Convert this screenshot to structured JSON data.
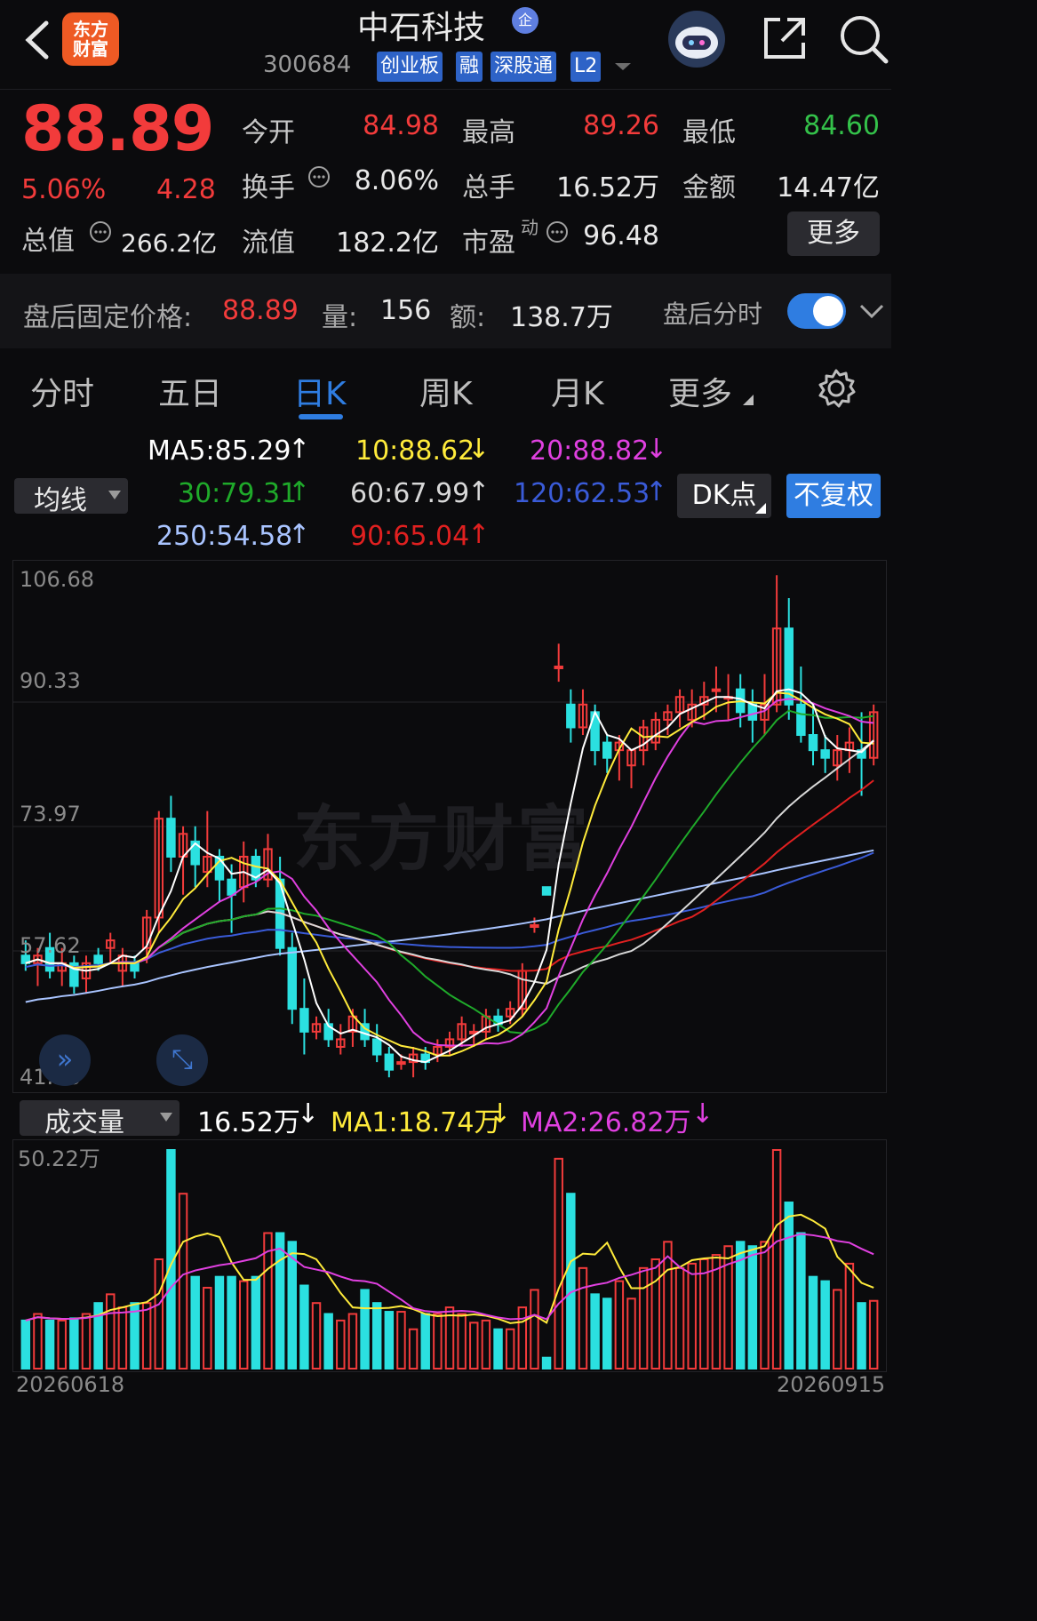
{
  "header": {
    "logo": "东方\n财富",
    "title": "中石科技",
    "qi_badge": "企",
    "code": "300684",
    "tags": [
      "创业板",
      "融",
      "深股通",
      "L2"
    ]
  },
  "quote": {
    "price": "88.89",
    "change_pct": "5.06%",
    "change": "4.28",
    "open_label": "今开",
    "open": "84.98",
    "high_label": "最高",
    "high": "89.26",
    "low_label": "最低",
    "low": "84.60",
    "turnover_label": "换手",
    "turnover": "8.06%",
    "volume_label": "总手",
    "volume": "16.52万",
    "amount_label": "金额",
    "amount": "14.47亿",
    "mcap_label": "总值",
    "mcap": "266.2亿",
    "float_label": "流值",
    "float": "182.2亿",
    "pe_label": "市盈",
    "pe_sup": "动",
    "pe": "96.48",
    "more_label": "更多"
  },
  "afterhours": {
    "price_label": "盘后固定价格:",
    "price": "88.89",
    "vol_label": "量:",
    "vol": "156",
    "amt_label": "额:",
    "amt": "138.7万",
    "toggle_label": "盘后分时"
  },
  "tabs": [
    "分时",
    "五日",
    "日K",
    "周K",
    "月K",
    "更多"
  ],
  "ma_row": {
    "selector": "均线",
    "ma5": "MA5:85.29",
    "ma10": "10:88.62",
    "ma20": "20:88.82",
    "ma30": "30:79.31",
    "ma60": "60:67.99",
    "ma120": "120:62.53",
    "ma250": "250:54.58",
    "ma90": "90:65.04",
    "dk": "DK点",
    "fq": "不复权"
  },
  "main_axis": {
    "top": "106.68",
    "l2": "90.33",
    "l3": "73.97",
    "l4": "57.62",
    "bottom": "41.26"
  },
  "volume_panel": {
    "selector": "成交量",
    "value": "16.52万",
    "ma1": "MA1:18.74万",
    "ma2": "MA2:26.82万",
    "axis_top": "50.22万",
    "date_start": "20260618",
    "date_end": "20260915"
  },
  "watermark": "东方财富",
  "colors": {
    "up": "#f23b3b",
    "down": "#2be0e0",
    "ma5": "#ffffff",
    "ma10": "#ffeb3b",
    "ma20": "#e040e0",
    "ma30": "#1faa2a",
    "ma60": "#d8d8d8",
    "ma120": "#3a5bd8",
    "ma250": "#a9c4ff",
    "ma90": "#e02020",
    "accent": "#2f7de1"
  },
  "chart_data": {
    "type": "candlestick",
    "candles": [
      [
        57,
        59,
        55,
        56
      ],
      [
        56,
        58,
        53,
        57
      ],
      [
        58,
        60,
        54,
        55
      ],
      [
        55,
        58,
        53,
        56
      ],
      [
        56,
        57,
        52,
        53
      ],
      [
        54,
        57,
        52,
        56
      ],
      [
        57,
        58,
        55,
        56
      ],
      [
        58,
        60,
        56,
        59
      ],
      [
        55,
        58,
        53,
        57
      ],
      [
        56,
        57,
        54,
        55
      ],
      [
        58,
        63,
        56,
        62
      ],
      [
        62,
        76,
        60,
        75
      ],
      [
        75,
        78,
        68,
        70
      ],
      [
        70,
        74,
        65,
        73
      ],
      [
        72,
        74,
        66,
        69
      ],
      [
        68,
        76,
        66,
        70
      ],
      [
        70,
        71,
        64,
        67
      ],
      [
        67,
        69,
        60,
        65
      ],
      [
        66,
        72,
        64,
        70
      ],
      [
        70,
        71,
        66,
        67
      ],
      [
        67,
        73,
        66,
        71
      ],
      [
        67,
        70,
        57,
        58
      ],
      [
        58,
        60,
        48,
        50
      ],
      [
        50,
        54,
        44,
        47
      ],
      [
        47,
        49,
        46,
        48
      ],
      [
        48,
        50,
        45,
        46
      ],
      [
        45,
        48,
        44,
        46
      ],
      [
        47,
        50,
        45,
        49
      ],
      [
        48,
        50,
        45,
        46
      ],
      [
        46,
        48,
        43,
        44
      ],
      [
        44,
        45,
        41,
        42
      ],
      [
        43,
        44,
        42,
        43
      ],
      [
        43,
        45,
        41,
        44
      ],
      [
        44,
        45,
        42,
        43
      ],
      [
        44,
        46,
        43,
        45
      ],
      [
        45,
        47,
        44,
        46
      ],
      [
        46,
        49,
        45,
        48
      ],
      [
        47,
        48,
        45,
        47
      ],
      [
        47,
        50,
        46,
        49
      ],
      [
        49,
        50,
        47,
        48
      ],
      [
        49,
        51,
        48,
        50
      ],
      [
        50,
        56,
        49,
        55
      ],
      [
        61,
        62,
        60,
        61
      ],
      [
        66,
        66,
        65,
        65
      ],
      [
        95,
        98,
        93,
        95
      ],
      [
        90,
        92,
        85,
        87
      ],
      [
        87,
        92,
        86,
        90
      ],
      [
        89,
        90,
        82,
        84
      ],
      [
        85,
        86,
        81,
        83
      ],
      [
        84,
        86,
        80,
        85
      ],
      [
        82,
        84,
        79,
        84
      ],
      [
        84,
        88,
        82,
        87
      ],
      [
        85,
        89,
        84,
        88
      ],
      [
        88,
        90,
        86,
        89
      ],
      [
        89,
        92,
        87,
        91
      ],
      [
        88,
        92,
        87,
        90
      ],
      [
        90,
        93,
        88,
        91
      ],
      [
        92,
        95,
        89,
        92
      ],
      [
        91,
        94,
        88,
        91
      ],
      [
        92,
        94,
        87,
        89
      ],
      [
        90,
        92,
        85,
        88
      ],
      [
        88,
        94,
        86,
        90
      ],
      [
        90,
        107,
        89,
        100
      ],
      [
        100,
        104,
        88,
        90
      ],
      [
        90,
        95,
        85,
        86
      ],
      [
        86,
        90,
        82,
        84
      ],
      [
        84,
        86,
        81,
        83
      ],
      [
        82,
        86,
        80,
        84
      ],
      [
        84,
        87,
        81,
        85
      ],
      [
        84,
        89,
        78,
        83
      ],
      [
        83,
        90,
        82,
        89
      ]
    ],
    "ylim": [
      41.26,
      106.68
    ],
    "volume": [
      0.22,
      0.25,
      0.22,
      0.22,
      0.23,
      0.25,
      0.3,
      0.34,
      0.28,
      0.3,
      0.3,
      0.5,
      1.0,
      0.8,
      0.42,
      0.37,
      0.42,
      0.42,
      0.4,
      0.42,
      0.62,
      0.62,
      0.58,
      0.38,
      0.3,
      0.25,
      0.22,
      0.25,
      0.36,
      0.3,
      0.26,
      0.26,
      0.18,
      0.25,
      0.25,
      0.28,
      0.25,
      0.21,
      0.22,
      0.18,
      0.18,
      0.28,
      0.36,
      0.05,
      0.96,
      0.8,
      0.46,
      0.34,
      0.32,
      0.4,
      0.32,
      0.46,
      0.5,
      0.58,
      0.46,
      0.48,
      0.5,
      0.52,
      0.56,
      0.58,
      0.56,
      0.58,
      1.0,
      0.76,
      0.62,
      0.42,
      0.4,
      0.36,
      0.48,
      0.3,
      0.31
    ],
    "volume_ylim": [
      0,
      50.22
    ]
  }
}
